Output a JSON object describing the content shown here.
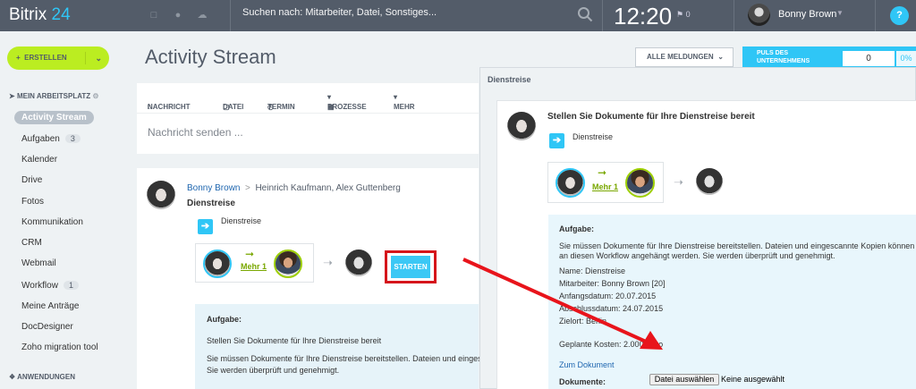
{
  "topbar": {
    "logo_brand": "Bitrix",
    "logo_num": "24",
    "search_placeholder": "Suchen nach: Mitarbeiter, Datei, Sonstiges...",
    "time": "12:20",
    "flag_count": "0",
    "user_name": "Bonny Brown",
    "help": "?"
  },
  "sidebar": {
    "create_label": "ERSTELLEN",
    "workplace_heading": "MEIN ARBEITSPLATZ",
    "items": [
      {
        "label": "Activity Stream"
      },
      {
        "label": "Aufgaben",
        "count": "3"
      },
      {
        "label": "Kalender"
      },
      {
        "label": "Drive"
      },
      {
        "label": "Fotos"
      },
      {
        "label": "Kommunikation"
      },
      {
        "label": "CRM"
      },
      {
        "label": "Webmail"
      },
      {
        "label": "Workflow",
        "count": "1"
      },
      {
        "label": "Meine Anträge"
      },
      {
        "label": "DocDesigner"
      },
      {
        "label": "Zoho migration tool"
      }
    ],
    "apps_heading": "ANWENDUNGEN"
  },
  "main": {
    "title": "Activity Stream",
    "filter_label": "ALLE MELDUNGEN",
    "pulse_label": "PULS DES UNTERNEHMENS",
    "pulse_value": "0",
    "pulse_percent": "0%",
    "tabs": [
      "NACHRICHT",
      "DATEI",
      "TERMIN",
      "PROZESSE",
      "MEHR"
    ],
    "compose_placeholder": "Nachricht senden ..."
  },
  "post": {
    "author": "Bonny Brown",
    "recipients": "Heinrich Kaufmann, Alex Guttenberg",
    "title": "Dienstreise",
    "doc_label": "Dienstreise",
    "mehr": "Mehr 1",
    "start_label": "STARTEN",
    "task_heading": "Aufgabe:",
    "task_line1": "Stellen Sie Dokumente für Ihre Dienstreise bereit",
    "task_line2": "Sie müssen Dokumente für Ihre Dienstreise bereitstellen. Dateien und eingesc",
    "task_line3": "Sie werden überprüft und genehmigt."
  },
  "modal": {
    "title": "Dienstreise",
    "heading": "Stellen Sie Dokumente für Ihre Dienstreise bereit",
    "doc_label": "Dienstreise",
    "mehr": "Mehr 1",
    "task_heading": "Aufgabe:",
    "desc1": "Sie müssen Dokumente für Ihre Dienstreise bereitstellen. Dateien und eingescannte Kopien können",
    "desc2": "an diesen Workflow angehängt werden. Sie werden überprüft und genehmigt.",
    "name": "Name: Dienstreise",
    "employee": "Mitarbeiter: Bonny Brown [20]",
    "start_date": "Anfangsdatum: 20.07.2015",
    "end_date": "Abschlussdatum: 24.07.2015",
    "destination": "Zielort: Berlin",
    "costs": "Geplante Kosten: 2.000 Euro",
    "doc_link": "Zum Dokument",
    "docs_label": "Dokumente:",
    "file_button": "Datei auswählen",
    "file_status": "Keine ausgewählt"
  },
  "colors": {
    "topbar": "#535c69",
    "accent": "#2fc6f6",
    "create": "#bbed21",
    "highlight": "#d5151b"
  }
}
